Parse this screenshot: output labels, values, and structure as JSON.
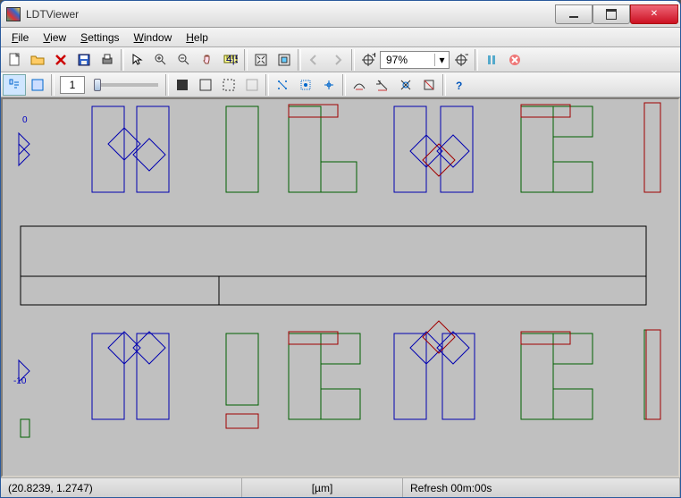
{
  "window": {
    "title": "LDTViewer"
  },
  "menu": {
    "file": "File",
    "view": "View",
    "settings": "Settings",
    "window": "Window",
    "help": "Help"
  },
  "toolbar": {
    "zoom_value": "97%",
    "page_value": "1"
  },
  "axis": {
    "y_top": "0",
    "y_bottom": "-10"
  },
  "status": {
    "coordinates": "(20.8239, 1.2747)",
    "units": "[µm]",
    "refresh": "Refresh 00m:00s"
  },
  "icons": {
    "new": "new-file-icon",
    "open": "open-folder-icon",
    "delete": "delete-x-icon",
    "save": "save-disk-icon",
    "print": "printer-icon",
    "pointer": "pointer-icon",
    "zoom_in": "zoom-in-icon",
    "zoom_out": "zoom-out-icon",
    "pan": "pan-hand-icon",
    "measure": "measure-icon",
    "fit": "fit-window-icon",
    "fit_all": "fit-all-icon",
    "prev": "arrow-left-icon",
    "next": "arrow-right-icon",
    "zoom_to": "zoom-target-icon",
    "zoom_reset": "zoom-reset-icon",
    "pause": "pause-icon",
    "stop": "stop-icon",
    "lasso": "lasso-select-icon",
    "rect_select": "rect-select-icon",
    "grid_dark": "grid-dark-icon",
    "grid_border": "grid-border-icon",
    "grid_dotted": "grid-dotted-icon",
    "grid_light": "grid-light-icon",
    "snap_point": "snap-point-icon",
    "snap_mid": "snap-mid-icon",
    "snap_grid": "snap-grid-icon",
    "layer_a": "layer-a-icon",
    "layer_b": "layer-b-icon",
    "layer_c": "layer-c-icon",
    "layer_d": "layer-d-icon",
    "help": "help-icon"
  }
}
